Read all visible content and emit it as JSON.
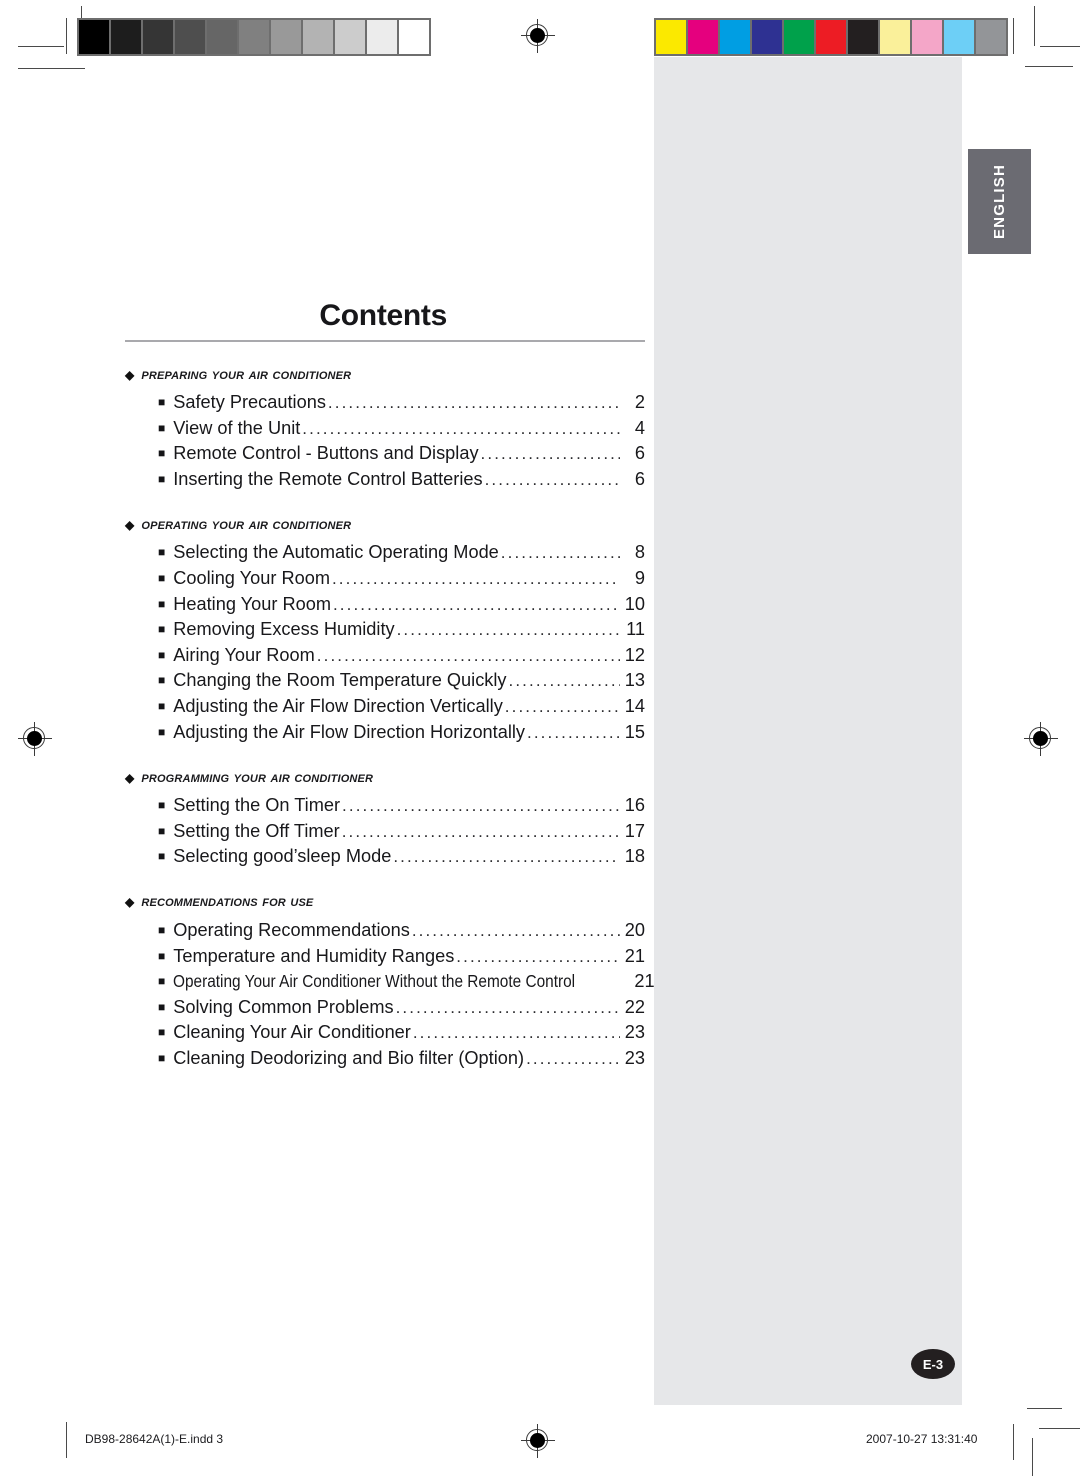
{
  "document": {
    "title": "Contents",
    "language_tab": "ENGLISH",
    "page_badge": "E-3"
  },
  "sections": [
    {
      "heading": "PREPARING YOUR AIR CONDITIONER",
      "items": [
        {
          "label": "Safety Precautions",
          "page": "2"
        },
        {
          "label": "View of the Unit",
          "page": "4"
        },
        {
          "label": "Remote Control - Buttons and Display",
          "page": "6"
        },
        {
          "label": "Inserting the Remote Control Batteries",
          "page": "6"
        }
      ]
    },
    {
      "heading": "OPERATING YOUR AIR CONDITIONER",
      "items": [
        {
          "label": "Selecting the Automatic Operating Mode",
          "page": "8"
        },
        {
          "label": "Cooling Your Room",
          "page": "9"
        },
        {
          "label": "Heating Your Room",
          "page": "10"
        },
        {
          "label": "Removing Excess Humidity",
          "page": "11"
        },
        {
          "label": "Airing Your Room",
          "page": "12"
        },
        {
          "label": "Changing the Room Temperature Quickly",
          "page": "13"
        },
        {
          "label": "Adjusting the Air Flow Direction Vertically",
          "page": "14"
        },
        {
          "label": "Adjusting the Air Flow Direction Horizontally",
          "page": "15"
        }
      ]
    },
    {
      "heading": "PROGRAMMING YOUR AIR CONDITIONER",
      "items": [
        {
          "label": "Setting the On Timer",
          "page": "16"
        },
        {
          "label": "Setting the Off Timer",
          "page": "17"
        },
        {
          "label": "Selecting good’sleep Mode",
          "page": "18"
        }
      ]
    },
    {
      "heading": "RECOMMENDATIONS FOR USE",
      "items": [
        {
          "label": "Operating Recommendations",
          "page": "20"
        },
        {
          "label": "Temperature and Humidity Ranges",
          "page": "21"
        },
        {
          "label": "Operating Your Air Conditioner Without the Remote Control",
          "page": "21",
          "condensed": true
        },
        {
          "label": "Solving Common Problems",
          "page": "22"
        },
        {
          "label": "Cleaning Your Air Conditioner",
          "page": "23"
        },
        {
          "label": "Cleaning Deodorizing and Bio filter (Option)",
          "page": "23"
        }
      ]
    }
  ],
  "footer": {
    "file": "DB98-28642A(1)-E.indd   3",
    "timestamp": "2007-10-27   13:31:40"
  },
  "print_marks": {
    "grayscale_bar": [
      "#000000",
      "#1d1d1d",
      "#353535",
      "#4e4e4e",
      "#666666",
      "#808080",
      "#999999",
      "#b3b3b3",
      "#cccccc",
      "#ececec",
      "#ffffff"
    ],
    "color_bar": [
      "#fbe900",
      "#e5007e",
      "#009ee3",
      "#2e3192",
      "#00a14b",
      "#ed1c24",
      "#231f20",
      "#faf09a",
      "#f4a6c8",
      "#6dcff6",
      "#939598"
    ],
    "bullet_section": "◆",
    "bullet_item": "■",
    "leader_char": "."
  }
}
